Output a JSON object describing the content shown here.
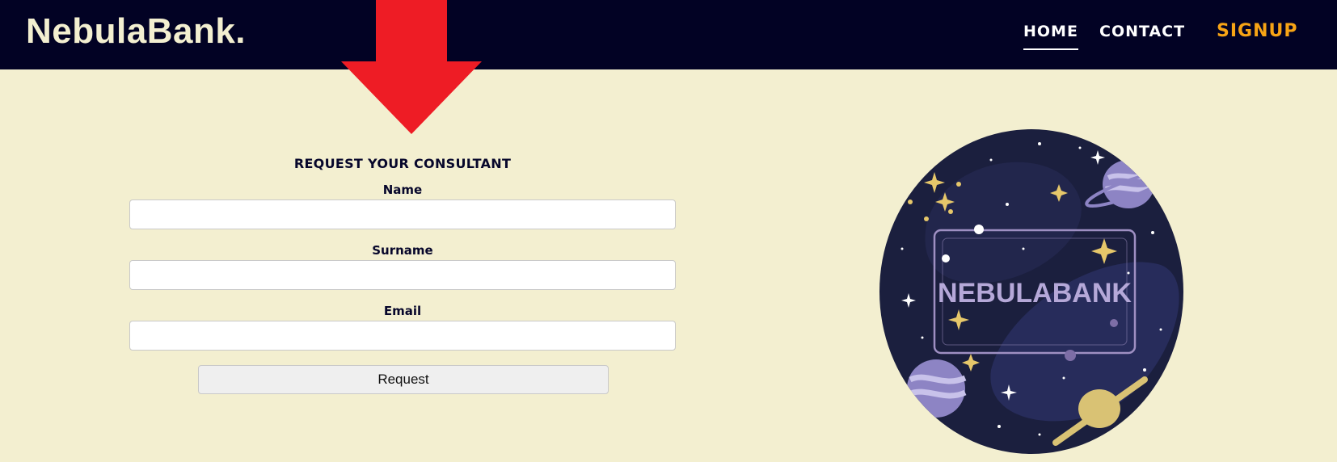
{
  "brand": {
    "name": "NebulaBank."
  },
  "nav": {
    "home": "HOME",
    "contact": "CONTACT",
    "signup": "SIGNUP"
  },
  "form": {
    "title": "REQUEST YOUR CONSULTANT",
    "name_label": "Name",
    "surname_label": "Surname",
    "email_label": "Email",
    "name_value": "",
    "surname_value": "",
    "email_value": "",
    "submit_label": "Request"
  },
  "logo": {
    "text": "NEBULABANK"
  },
  "colors": {
    "navbar": "#020224",
    "page_background": "#f3efd0",
    "brand_text": "#f3efd0",
    "signup": "#f7a415",
    "annotation_arrow": "#ee1c25"
  },
  "annotation": {
    "icon": "red-down-arrow-icon"
  }
}
